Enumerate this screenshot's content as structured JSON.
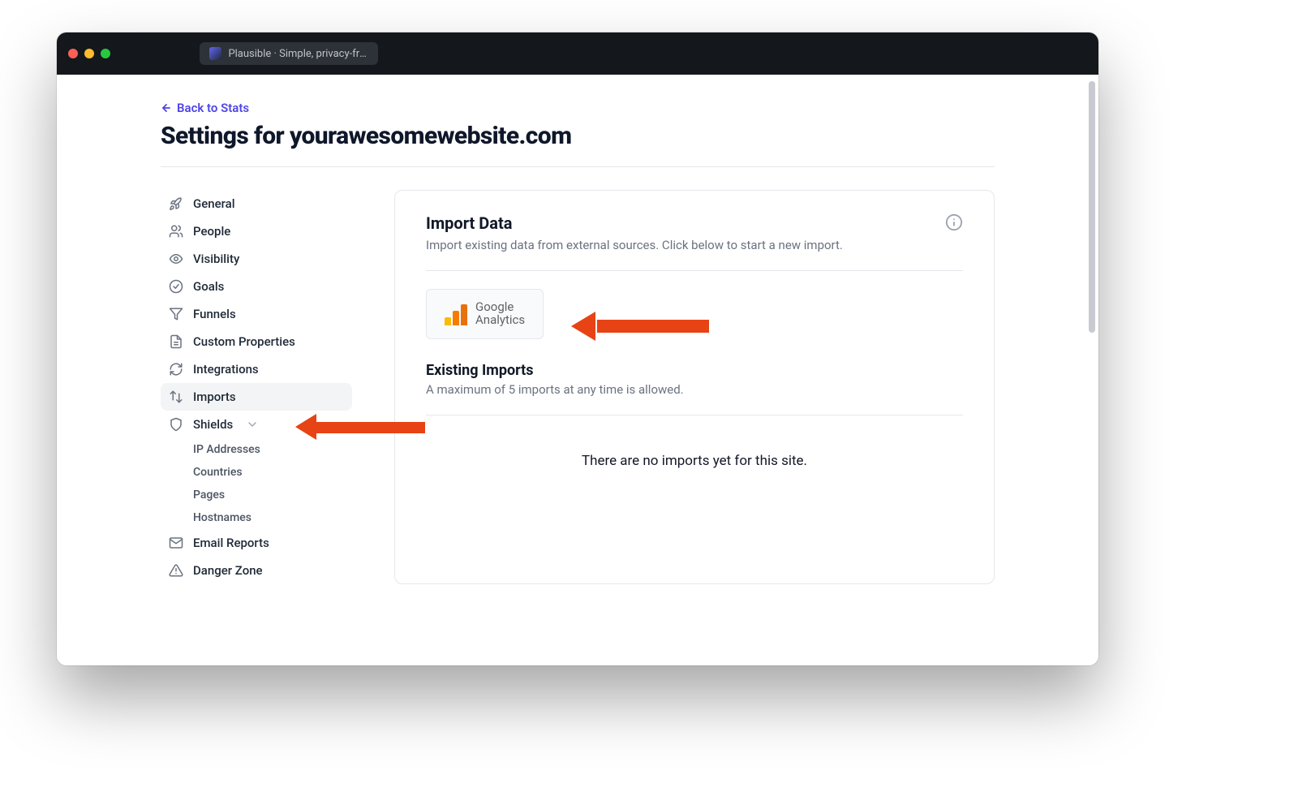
{
  "browser": {
    "tab_title": "Plausible · Simple, privacy-frien"
  },
  "header": {
    "back_label": "Back to Stats",
    "page_title": "Settings for yourawesomewebsite.com"
  },
  "sidebar": {
    "items": [
      {
        "label": "General"
      },
      {
        "label": "People"
      },
      {
        "label": "Visibility"
      },
      {
        "label": "Goals"
      },
      {
        "label": "Funnels"
      },
      {
        "label": "Custom Properties"
      },
      {
        "label": "Integrations"
      },
      {
        "label": "Imports"
      },
      {
        "label": "Shields"
      }
    ],
    "shields_sub": [
      {
        "label": "IP Addresses"
      },
      {
        "label": "Countries"
      },
      {
        "label": "Pages"
      },
      {
        "label": "Hostnames"
      }
    ],
    "tail": [
      {
        "label": "Email Reports"
      },
      {
        "label": "Danger Zone"
      }
    ]
  },
  "panel": {
    "title": "Import Data",
    "subtitle": "Import existing data from external sources. Click below to start a new import.",
    "ga_line1": "Google",
    "ga_line2": "Analytics",
    "existing_title": "Existing Imports",
    "existing_sub": "A maximum of 5 imports at any time is allowed.",
    "empty": "There are no imports yet for this site."
  }
}
